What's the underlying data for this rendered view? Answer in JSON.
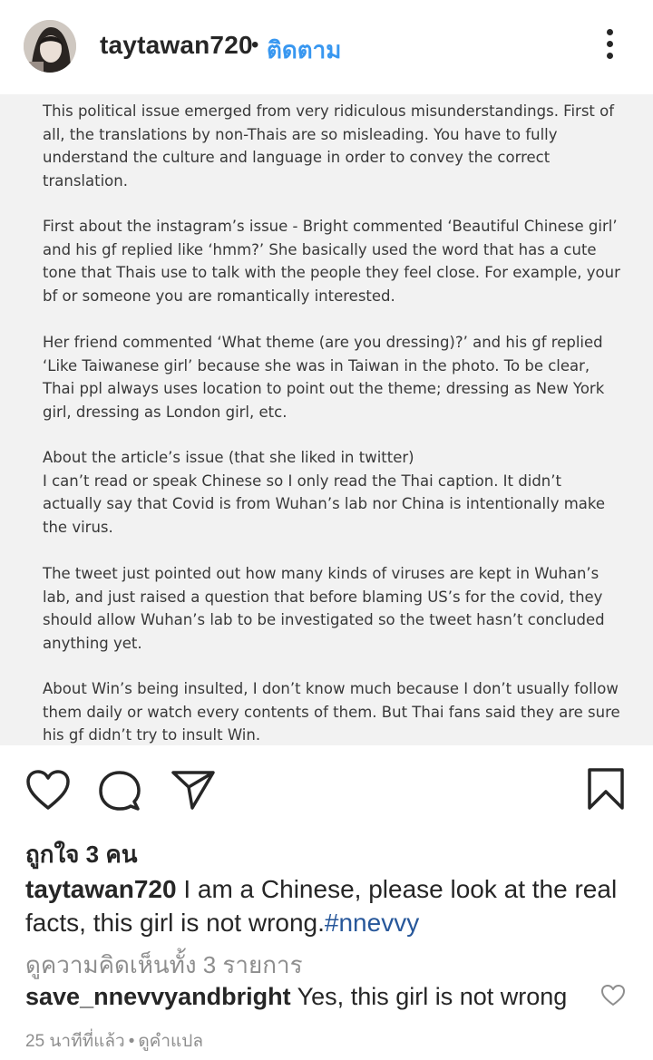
{
  "header": {
    "username": "taytawan720",
    "dot": "•",
    "follow_label": "ติดตาม"
  },
  "post": {
    "paragraphs": [
      [
        "This political issue emerged from very ridiculous misunderstandings.  First of",
        "all, the translations by non-Thais are so misleading. You have to fully",
        "understand the culture and language in order to convey the correct",
        "translation."
      ],
      [
        "First about the instagram’s issue - Bright commented ‘Beautiful Chinese girl’",
        "and his gf replied like ‘hmm?’ She basically used the word that has a cute",
        "tone that Thais use to talk with the people they feel close. For example, your",
        "bf or someone you are romantically interested."
      ],
      [
        "Her friend commented ‘What theme (are you dressing)?’ and his gf replied",
        "‘Like Taiwanese girl’ because she was in Taiwan in the photo. To be clear,",
        "Thai ppl always uses location to point out the theme; dressing as New York",
        "girl, dressing as London girl, etc."
      ],
      [
        "About the article’s issue (that she liked in twitter)",
        "I can’t read or speak Chinese so I only read the Thai caption. It didn’t",
        "actually say that Covid is from Wuhan’s lab nor China is intentionally make",
        "the virus."
      ],
      [
        "The tweet just pointed out how many kinds of viruses are kept in Wuhan’s",
        "lab, and just raised a question that before blaming US’s for the covid, they",
        "should allow Wuhan’s lab to be investigated so the tweet hasn’t concluded",
        "anything yet."
      ],
      [
        "About Win’s being insulted, I don’t know much because I don’t usually follow",
        "them daily or watch every contents of them. But Thai fans said they are sure",
        "his gf didn’t try to insult Win."
      ]
    ]
  },
  "likes": "ถูกใจ 3 คน",
  "caption": {
    "username": "taytawan720",
    "text": " I am a Chinese, please look at the real facts, this girl is not wrong.",
    "hashtag": "#nnevvy"
  },
  "view_all_comments": "ดูความคิดเห็นทั้ง 3 รายการ",
  "comment": {
    "username": "save_nnevvyandbright",
    "text": " Yes, this girl is not wrong"
  },
  "meta": {
    "time": "25 นาทีที่แล้ว",
    "sep": "•",
    "translate": "ดูคำแปล"
  },
  "icons": [
    "heart-icon",
    "comment-icon",
    "share-icon",
    "bookmark-icon",
    "more-icon"
  ]
}
